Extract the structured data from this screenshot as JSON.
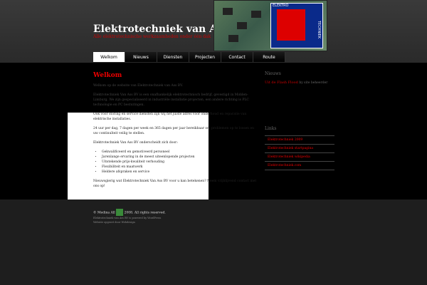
{
  "site": {
    "title": "Elektrotechniek van Ass BV",
    "tagline": "Alle elektrotechnische werkzaamheden onder één dak"
  },
  "logo": {
    "top_text": "ELEKTRO",
    "side_text": "TECHNIEK"
  },
  "nav": {
    "items": [
      "Welkom",
      "Nieuws",
      "Diensten",
      "Projecten",
      "Contact",
      "Route"
    ],
    "active": "Welkom"
  },
  "content": {
    "heading": "Welkom",
    "intro": "Welkom op de website van Elektrotechniek van Ass BV.",
    "para1": "Elektrotechniek Van Ass BV is een onafhankelijk elektrotechnisch bedrijf, gevestigd in Midden-Limburg. We zijn gespecialiseerd in industriële installatie projecten, een andere richting is PLC technologie en PC besturingen.",
    "para2": "Ook voor storing en service diensten zijn wij het juiste adres voor onderhoud en reparatie van elektrische installaties.",
    "para3": "24 uur per dag, 7 dagen per week en 365 dagen per jaar bereikbaar om problemen op te lossen en uw continuïteit veilig te stellen.",
    "para4": "Elektrotechniek Van Ass BV onderscheidt zich door:",
    "bullets": [
      "Gekwalificeerd en gemotiveerd personeel",
      "Jarenlange ervaring in de meest uiteenlopende projecten",
      "Uitstekende prijs-kwaliteit verhouding",
      "Flexibiliteit en maatwerk",
      "Heldere afspraken en service"
    ],
    "para5": "Nieuwsgierig wat Elektrotechniek Van Ass BV voor u kan betekenen? Neem vrijblijvend contact met ons op!"
  },
  "sidebar": {
    "news_heading": "Nieuws",
    "news_link": "Uit de Flash Flood",
    "news_suffix": "by site beheerder",
    "links_heading": "Links",
    "links": [
      "Elektrotechniek 2009",
      "Elektrotechniek startpagina",
      "Elektrotechniek wikipedia",
      "Elektrotechniek.com"
    ]
  },
  "footer": {
    "copyright": "© Medina All",
    "rights": "2008. All rights reserved.",
    "line2": "Elektrotechniek van Ass BV is powered by WordPress",
    "line3": "Website opgezet door Webdesign"
  }
}
